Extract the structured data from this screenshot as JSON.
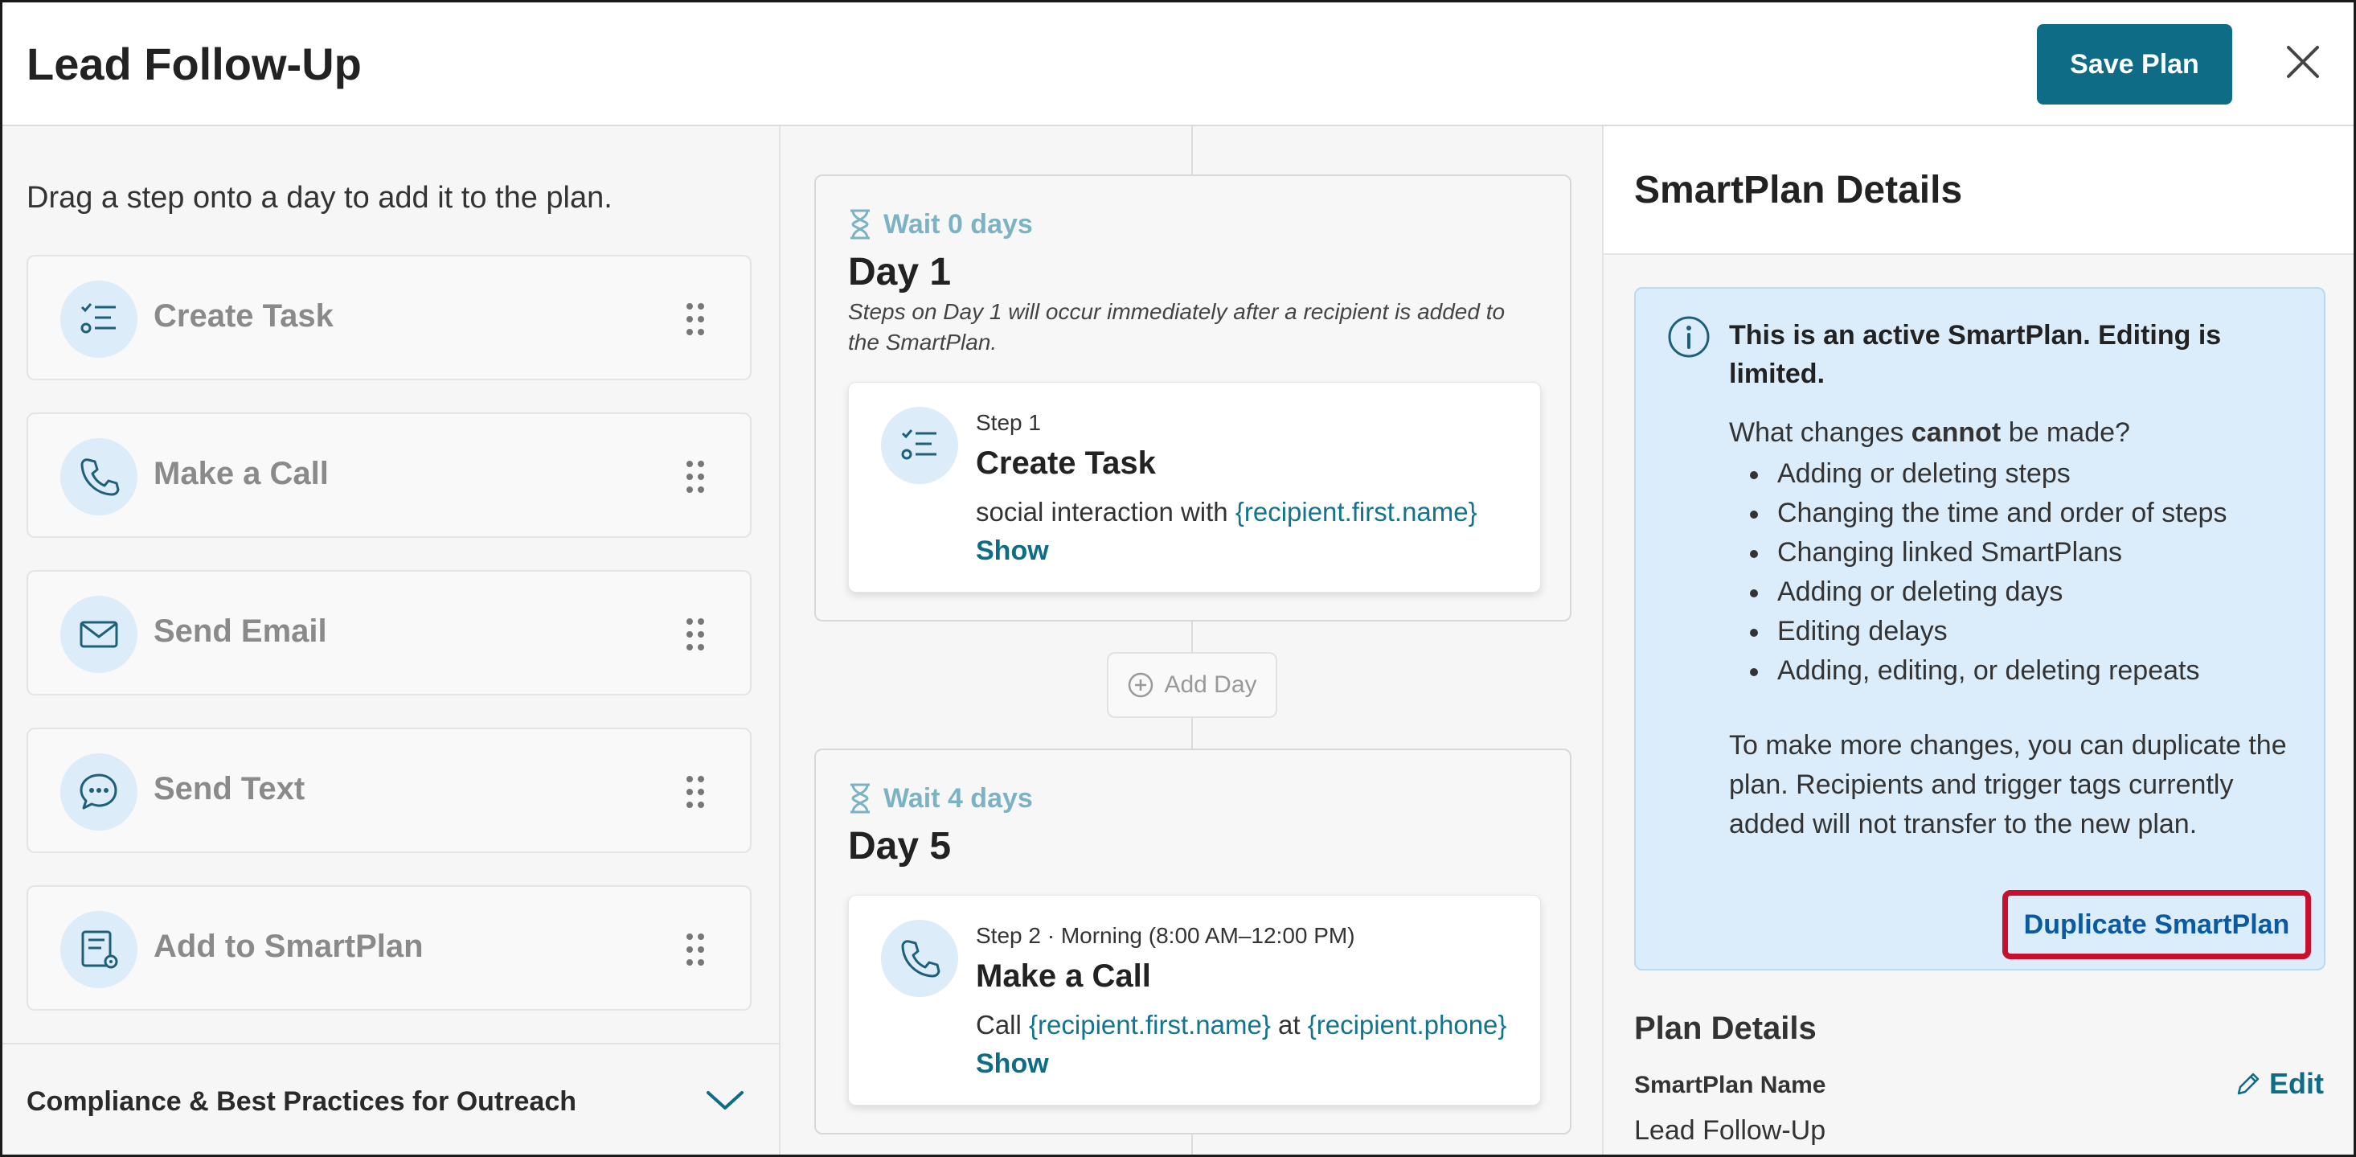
{
  "header": {
    "title": "Lead Follow-Up",
    "save_label": "Save Plan",
    "close_icon": "close-icon"
  },
  "left_panel": {
    "instruction": "Drag a step onto a day to add it to the plan.",
    "steps": [
      {
        "label": "Create Task",
        "icon": "task-list-icon"
      },
      {
        "label": "Make a Call",
        "icon": "phone-icon"
      },
      {
        "label": "Send Email",
        "icon": "envelope-icon"
      },
      {
        "label": "Send Text",
        "icon": "chat-bubble-icon"
      },
      {
        "label": "Add to SmartPlan",
        "icon": "smartplan-gear-icon"
      }
    ],
    "compliance_label": "Compliance & Best Practices for Outreach"
  },
  "middle_panel": {
    "days": [
      {
        "wait": "Wait 0 days",
        "title": "Day 1",
        "note": "Steps on Day 1 will occur immediately after a recipient is added to the SmartPlan.",
        "step": {
          "meta": "Step 1",
          "title": "Create Task",
          "body_prefix": "social interaction with ",
          "body_var": "{recipient.first.name}",
          "body_mid": "",
          "body_var2": "",
          "show": "Show"
        }
      },
      {
        "wait": "Wait 4 days",
        "title": "Day 5",
        "note": "",
        "step": {
          "meta": "Step 2 · Morning (8:00 AM–12:00 PM)",
          "title": "Make a Call",
          "body_prefix": "Call ",
          "body_var": "{recipient.first.name}",
          "body_mid": " at ",
          "body_var2": "{recipient.phone}",
          "show": "Show"
        }
      }
    ],
    "add_day_label": "Add Day"
  },
  "right_panel": {
    "title": "SmartPlan Details",
    "info": {
      "heading": "This is an active SmartPlan. Editing is limited.",
      "question_prefix": "What changes ",
      "question_bold": "cannot",
      "question_suffix": " be made?",
      "restrictions": [
        "Adding or deleting steps",
        "Changing the time and order of steps",
        "Changing linked SmartPlans",
        "Adding or deleting days",
        "Editing delays",
        "Adding, editing, or deleting repeats"
      ],
      "paragraph": "To make more changes, you can duplicate the plan. Recipients and trigger tags currently added will not transfer to the new plan.",
      "duplicate_label": "Duplicate SmartPlan"
    },
    "plan_details_title": "Plan Details",
    "plan_name_label": "SmartPlan Name",
    "plan_name_value": "Lead Follow-Up",
    "edit_label": "Edit"
  },
  "colors": {
    "primary": "#0e6c87",
    "info_bg": "#dbedfb",
    "highlight": "#c8102e",
    "wait_text": "#7bb3c4"
  }
}
